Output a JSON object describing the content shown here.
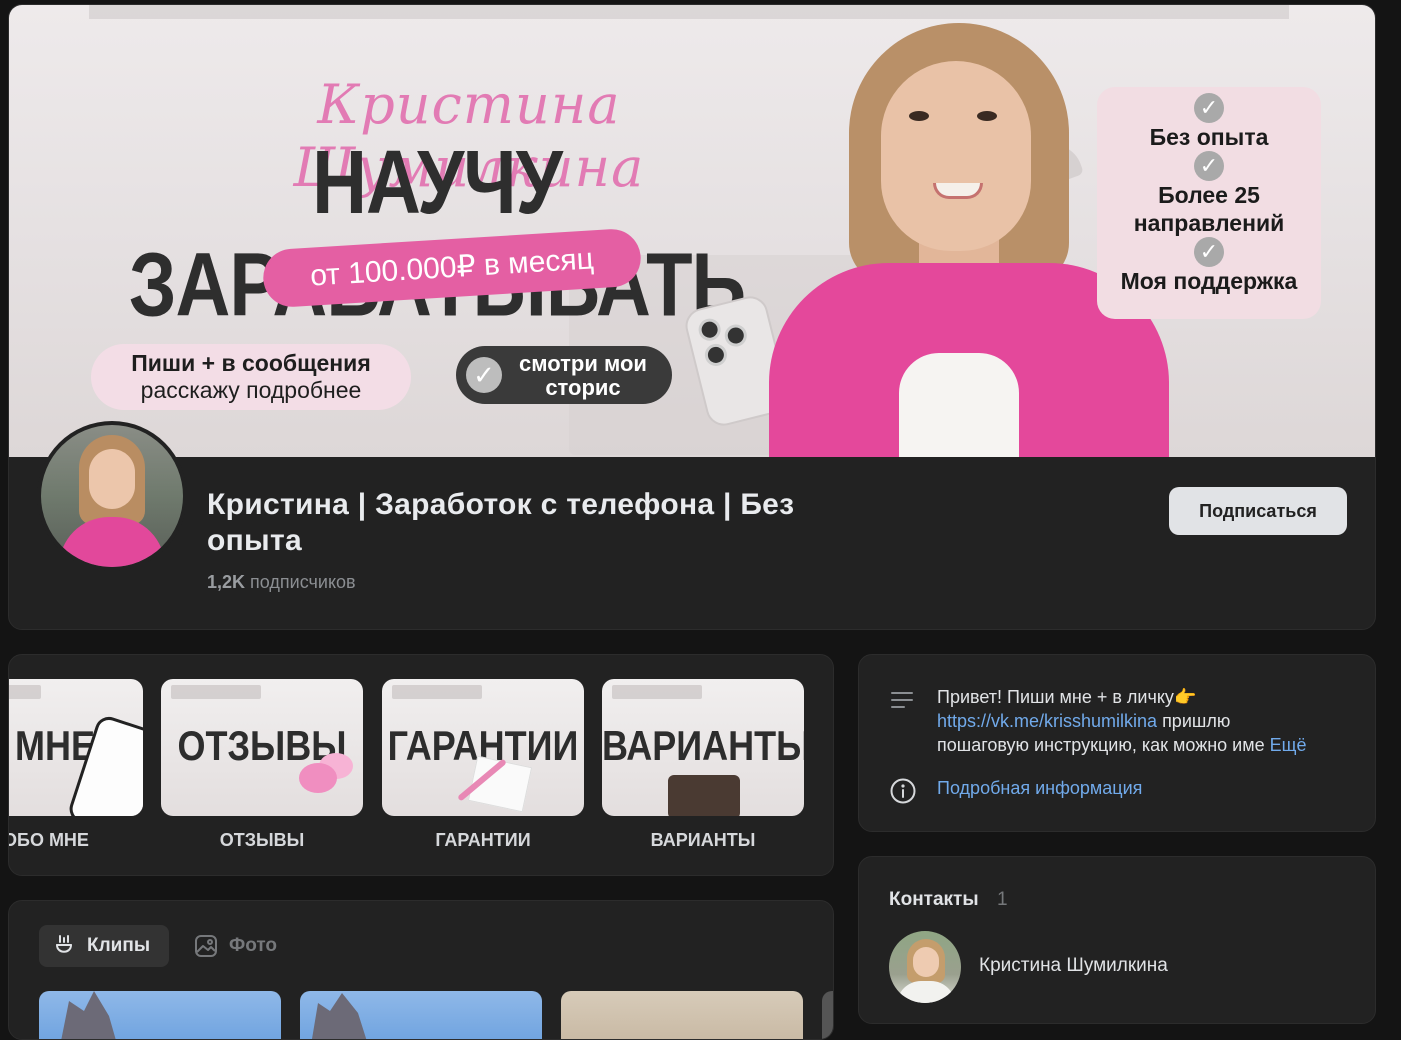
{
  "cover": {
    "script_name": "Кристина Шумилкина",
    "headline": "НАУЧУ ЗАРАБАТЫВАТЬ",
    "income_pill": "от 100.000₽ в месяц",
    "message_line1": "Пиши + в сообщения",
    "message_line2": "расскажу подробнее",
    "stories_line1": "смотри мои",
    "stories_line2": "сторис",
    "benefits": [
      "Без опыта",
      "Более 25 направлений",
      "Моя поддержка"
    ]
  },
  "profile": {
    "title": "Кристина | Заработок с телефона | Без опыта",
    "subscribers_count": "1,2K",
    "subscribers_label": "подписчиков",
    "subscribe_button": "Подписаться"
  },
  "highlights": [
    {
      "thumb_word": "МНЕ",
      "label": "ОБО МНЕ"
    },
    {
      "thumb_word": "ОТЗЫВЫ",
      "label": "ОТЗЫВЫ"
    },
    {
      "thumb_word": "ГАРАНТИИ",
      "label": "ГАРАНТИИ"
    },
    {
      "thumb_word": "ВАРИАНТЫ",
      "label": "ВАРИАНТЫ"
    }
  ],
  "tabs": {
    "clips": "Клипы",
    "photo": "Фото"
  },
  "info": {
    "description_start": "Привет! Пиши мне + в личку",
    "description_emoji": "👉",
    "link": "https://vk.me/krisshumilkina",
    "description_after_link": " пришлю",
    "description_line3": "пошаговую инструкцию, как можно име",
    "more": "Ещё",
    "details_link": "Подробная информация"
  },
  "contacts": {
    "title": "Контакты",
    "count": "1",
    "items": [
      {
        "name": "Кристина Шумилкина"
      }
    ]
  },
  "colors": {
    "background": "#141414",
    "card": "#222222",
    "accent_link": "#71aaeb",
    "brand_pink": "#e45fa3"
  }
}
